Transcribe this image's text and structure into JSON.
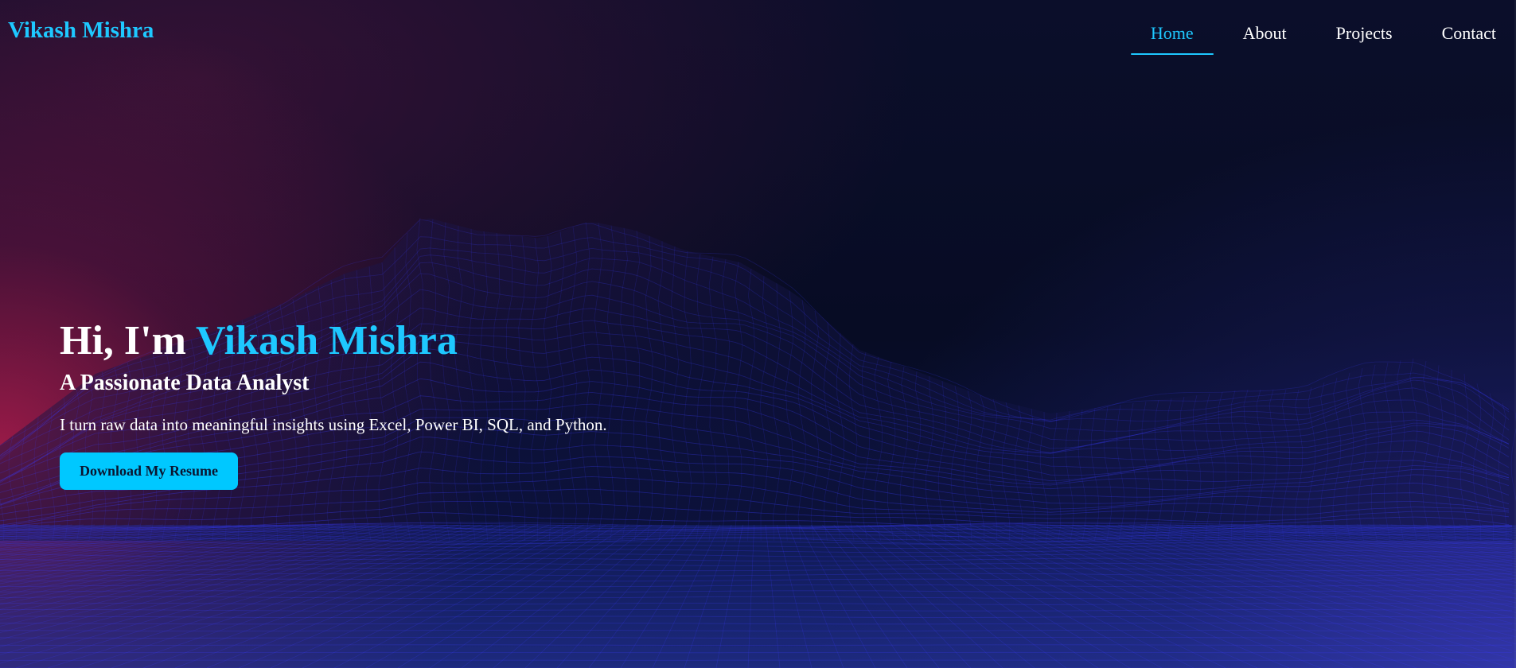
{
  "nav": {
    "logo": "Vikash Mishra",
    "links": [
      {
        "label": "Home",
        "active": true
      },
      {
        "label": "About",
        "active": false
      },
      {
        "label": "Projects",
        "active": false
      },
      {
        "label": "Contact",
        "active": false
      }
    ]
  },
  "hero": {
    "greeting": "Hi, I'm",
    "name": "Vikash Mishra",
    "subtitle": "A Passionate Data Analyst",
    "description": "I turn raw data into meaningful insights using Excel, Power BI, SQL, and Python.",
    "button_label": "Download My Resume"
  },
  "colors": {
    "accent": "#1ec8ff",
    "button_bg": "#00c8ff",
    "background": "#050a22",
    "wireframe": "#3a3cff",
    "glow_left": "#c81e50",
    "glow_right": "#503cc8"
  }
}
